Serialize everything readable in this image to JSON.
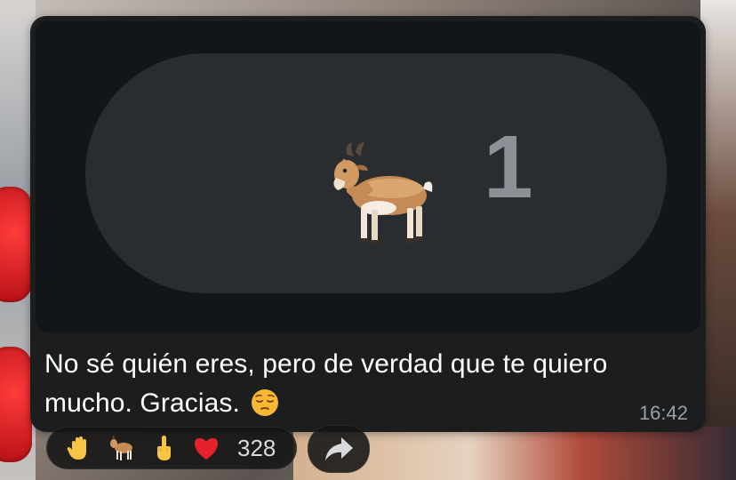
{
  "message": {
    "sticker": {
      "icon": "goat-icon",
      "count": "1"
    },
    "text_line1": "No sé quién eres, pero de verdad que te quiero",
    "text_line2": "mucho. Gracias.",
    "trailing_emoji": "pensive-face-icon",
    "time": "16:42"
  },
  "reactions": {
    "items": [
      {
        "icon": "raised-hand-icon"
      },
      {
        "icon": "goat-icon"
      },
      {
        "icon": "middle-finger-icon"
      },
      {
        "icon": "red-heart-icon"
      }
    ],
    "count": "328"
  },
  "forward": {
    "icon": "share-arrow-icon"
  },
  "colors": {
    "bubble_bg": "#1b1d1f",
    "pill_bg": "#2a2d30",
    "count_color": "#8b9196",
    "text": "#ffffff",
    "timestamp": "#9aa0a5"
  }
}
